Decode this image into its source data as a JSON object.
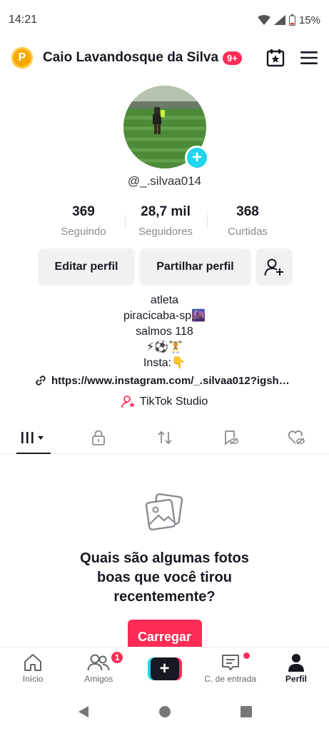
{
  "status": {
    "time": "14:21",
    "battery": "15%"
  },
  "header": {
    "username": "Caio Lavandosque da Silva",
    "notif_badge": "9+",
    "coin_letter": "P"
  },
  "profile": {
    "handle": "@_.silvaa014",
    "stats": [
      {
        "value": "369",
        "label": "Seguindo"
      },
      {
        "value": "28,7 mil",
        "label": "Seguidores"
      },
      {
        "value": "368",
        "label": "Curtidas"
      }
    ],
    "edit_label": "Editar perfil",
    "share_label": "Partilhar perfil",
    "bio": [
      "atleta",
      "piracicaba-sp🌆",
      "salmos 118",
      "⚡⚽🏋️",
      "Insta:👇"
    ],
    "link": "https://www.instagram.com/_.silvaa012?igsh…",
    "studio": "TikTok Studio"
  },
  "tabs": [
    "videos-tab",
    "private-tab",
    "reposts-tab",
    "favorites-tab",
    "liked-tab"
  ],
  "empty": {
    "title_line1": "Quais são algumas fotos",
    "title_line2": "boas que você tirou",
    "title_line3": "recentemente?",
    "upload_label": "Carregar"
  },
  "nav": {
    "home": "Início",
    "friends": "Amigos",
    "friends_badge": "1",
    "plus": "+",
    "inbox": "C. de entrada",
    "profile": "Perfil"
  },
  "colors": {
    "accent": "#fe2c55",
    "cyan": "#20d5ec",
    "text": "#161823"
  }
}
